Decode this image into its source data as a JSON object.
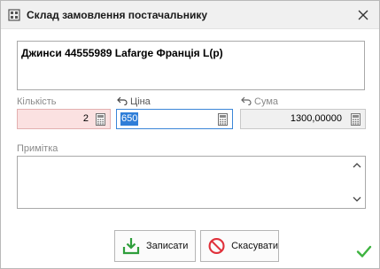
{
  "window": {
    "title": "Склад замовлення постачальнику"
  },
  "product": {
    "name": "Джинси 44555989 Lafarge Франція L(р)"
  },
  "fields": {
    "quantity": {
      "label": "Кількість",
      "value": "2"
    },
    "price": {
      "label": "Ціна",
      "value": "650"
    },
    "sum": {
      "label": "Сума",
      "value": "1300,00000"
    }
  },
  "note": {
    "label": "Примітка",
    "value": ""
  },
  "buttons": {
    "save_label": "Записати",
    "cancel_label": "Скасувати"
  },
  "colors": {
    "quantity_bg": "#fbe1e1",
    "price_highlight": "#2f7ed8",
    "save_icon": "#2e9e3b",
    "cancel_icon": "#e0303a",
    "ok_check": "#3db33f"
  },
  "icons": {
    "title": "warehouse-icon",
    "close": "close-icon",
    "revert": "revert-arrow-icon",
    "calculator": "calculator-icon",
    "save": "download-tray-icon",
    "cancel": "no-entry-icon",
    "ok": "checkmark-icon"
  }
}
